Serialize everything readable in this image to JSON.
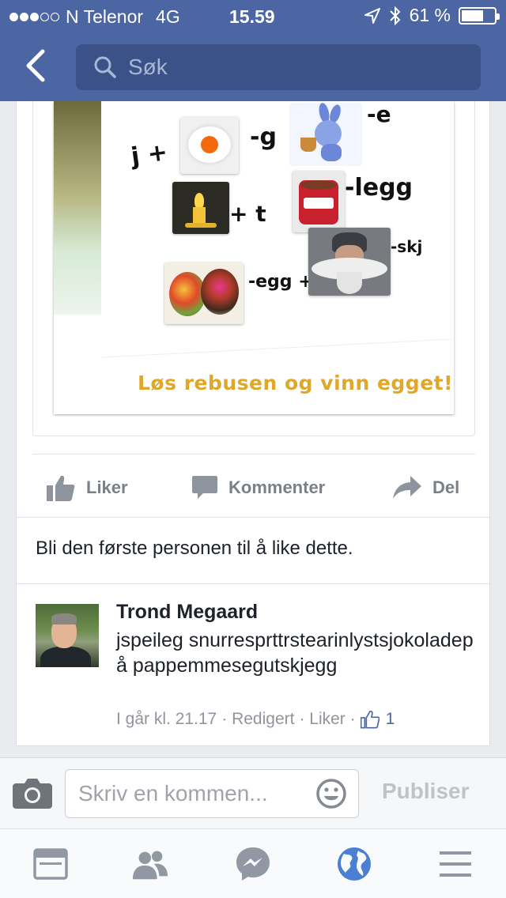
{
  "status": {
    "carrier": "N Telenor",
    "network": "4G",
    "time": "15.59",
    "battery": "61 %",
    "battery_level": 0.61
  },
  "nav": {
    "search_placeholder": "Søk"
  },
  "post": {
    "image": {
      "rebus_lines": [
        "j +",
        "-g",
        "-e",
        "+ t",
        "-legg",
        "-egg +",
        "-skj"
      ],
      "caption": "Løs rebusen og vinn egget!"
    },
    "actions": {
      "like": "Liker",
      "comment": "Kommenter",
      "share": "Del"
    },
    "likes_text": "Bli den første personen til å like dette."
  },
  "comment": {
    "author": "Trond Megaard",
    "text": "jspeileg snurresprttrstearinlystsjokoladepå pappemmesegutskjegg",
    "time": "I går kl. 21.17",
    "edited": "· Redigert",
    "like": "· Liker ·",
    "like_count": "1"
  },
  "composer": {
    "placeholder": "Skriv en kommen...",
    "publish": "Publiser"
  },
  "colors": {
    "brand": "#4c66a4",
    "caption": "#e0a82b",
    "link": "#4b66a3"
  }
}
